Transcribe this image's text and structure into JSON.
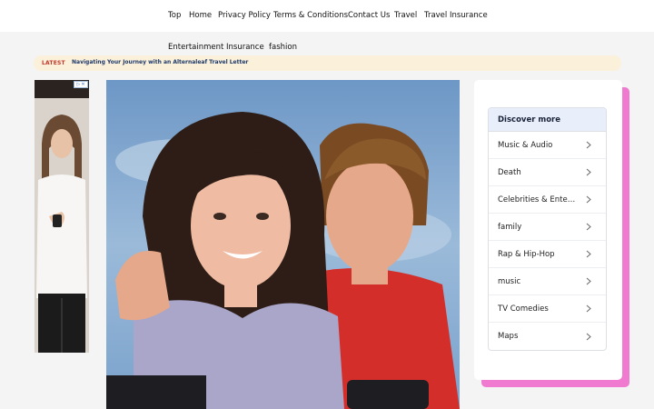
{
  "nav": {
    "top_links": [
      "Top",
      "Home",
      "Privacy Policy",
      "Terms & Conditions",
      "Contact Us",
      "Travel",
      "Travel Insurance"
    ],
    "sub_links": [
      "Entertainment",
      "Insurance",
      "fashion"
    ]
  },
  "ticker": {
    "tag": "LATEST",
    "headline": "Navigating Your Journey with an Alternaleaf Travel Letter"
  },
  "ad": {
    "badge_icon": "adchoices-icon",
    "close_icon": "close-icon"
  },
  "sidebar": {
    "discover_title": "Discover more",
    "items": [
      "Music & Audio",
      "Death",
      "Celebrities & Entertainment",
      "family",
      "Rap & Hip-Hop",
      "music",
      "TV Comedies",
      "Maps"
    ],
    "item_icon": "chevron-right-icon"
  },
  "colors": {
    "ticker_bg": "#fbf0d9",
    "ticker_tag": "#c0392b",
    "card_shadow": "#ef7ad0",
    "discover_head_bg": "#e8effb"
  }
}
